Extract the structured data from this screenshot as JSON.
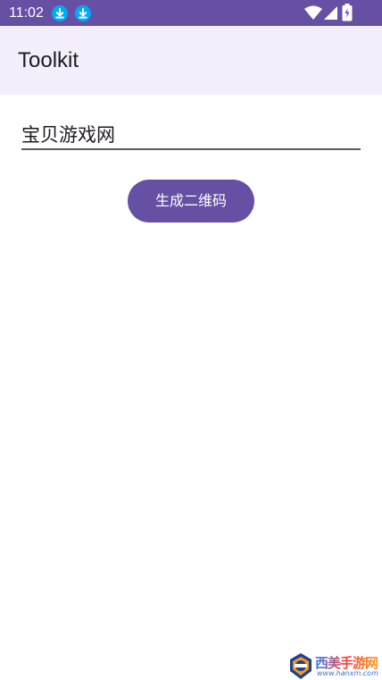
{
  "status_bar": {
    "time": "11:02",
    "notification_icons": [
      "download-icon",
      "download-icon"
    ],
    "system_icons": [
      "wifi-icon",
      "signal-icon",
      "battery-icon"
    ]
  },
  "app_bar": {
    "title": "Toolkit"
  },
  "input": {
    "value": "宝贝游戏网"
  },
  "actions": {
    "generate_label": "生成二维码"
  },
  "watermark": {
    "name": "西美手游网",
    "url": "www.hanxm.com"
  },
  "colors": {
    "primary": "#6650a4",
    "app_bar_bg": "#f3eefa",
    "download_badge": "#03a9f4"
  }
}
